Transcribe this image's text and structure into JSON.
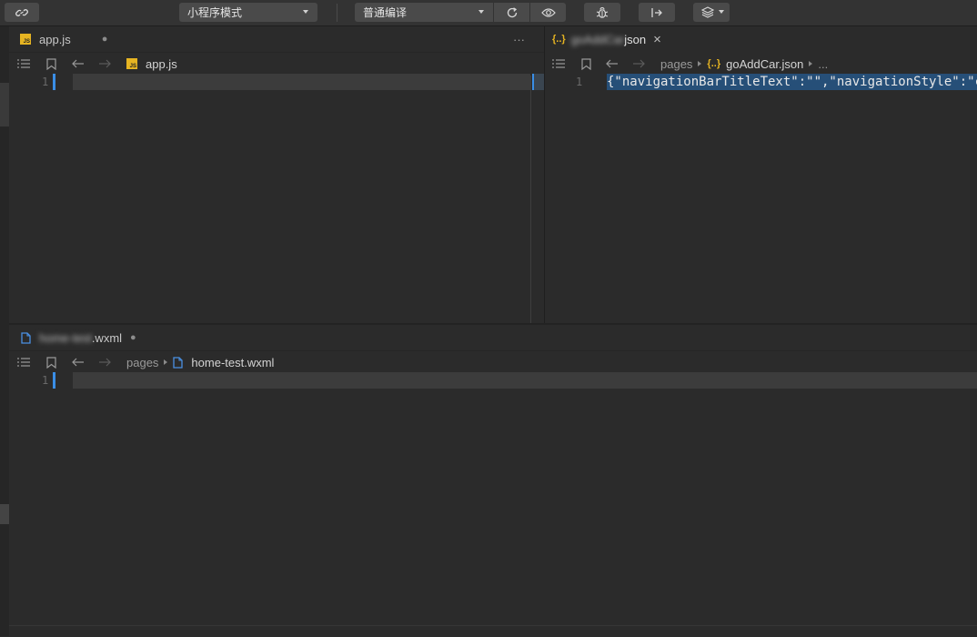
{
  "toolbar": {
    "mode_select": "小程序模式",
    "compile_select": "普通编译",
    "icons": [
      "link-icon",
      "refresh-icon",
      "preview-eye-icon",
      "debug-bug-icon",
      "upload-icon",
      "layers-icon"
    ]
  },
  "left_editor": {
    "tab": {
      "filename": "app.js",
      "dot": "●",
      "more": "···"
    },
    "breadcrumb": {
      "file": "app.js"
    },
    "line_numbers": [
      "1"
    ]
  },
  "right_editor": {
    "tab": {
      "filename_blurred": "goAddCar",
      "filename_suffix": "json",
      "close": "×",
      "json_badge": "{..}"
    },
    "breadcrumb": {
      "folder": "pages",
      "file": "goAddCar.json",
      "more": "..."
    },
    "line_numbers": [
      "1"
    ],
    "code_line": "{\"navigationBarTitleText\":\"\",\"navigationStyle\":\"c"
  },
  "bottom_editor": {
    "tab": {
      "filename_blurred": "home-test",
      "filename_suffix": ".wxml",
      "dot": "●"
    },
    "breadcrumb": {
      "folder": "pages",
      "file": "home-test.wxml"
    },
    "line_numbers": [
      "1"
    ]
  },
  "colors": {
    "background": "#2b2b2b",
    "accent": "#3a8ee6",
    "json_icon": "#e6b422",
    "selection": "#264f78"
  }
}
